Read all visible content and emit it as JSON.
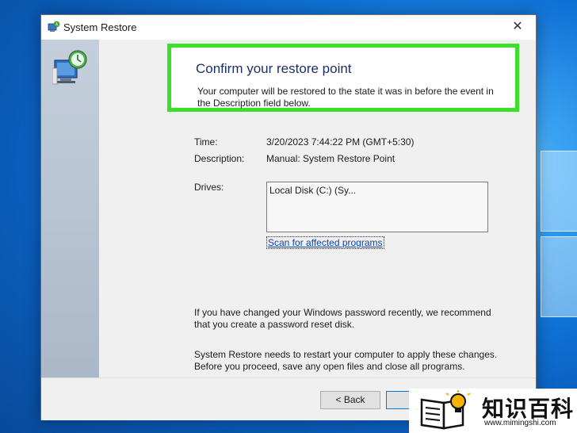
{
  "window": {
    "title": "System Restore",
    "close_label": "✕",
    "app_icon": "system-restore-icon"
  },
  "content": {
    "heading": "Confirm your restore point",
    "intro": "Your computer will be restored to the state it was in before the event in the Description field below.",
    "time_label": "Time:",
    "time_value": "3/20/2023 7:44:22 PM (GMT+5:30)",
    "description_label": "Description:",
    "description_value": "Manual: System Restore Point",
    "drives_label": "Drives:",
    "drives_items": [
      "Local Disk (C:) (Sy..."
    ],
    "scan_link": "Scan for affected programs",
    "password_note": "If you have changed your Windows password recently, we recommend that you create a password reset disk.",
    "restart_note": "System Restore needs to restart your computer to apply these changes. Before you proceed, save any open files and close all programs."
  },
  "footer": {
    "back_label": "< Back",
    "finish_label": "F"
  },
  "watermark": {
    "text": "知识百科",
    "url": "www.mimingshi.com"
  },
  "colors": {
    "highlight": "#3ce02a",
    "heading": "#1c2e5f",
    "link": "#0645ad",
    "desktop": "#0a6fd0"
  }
}
